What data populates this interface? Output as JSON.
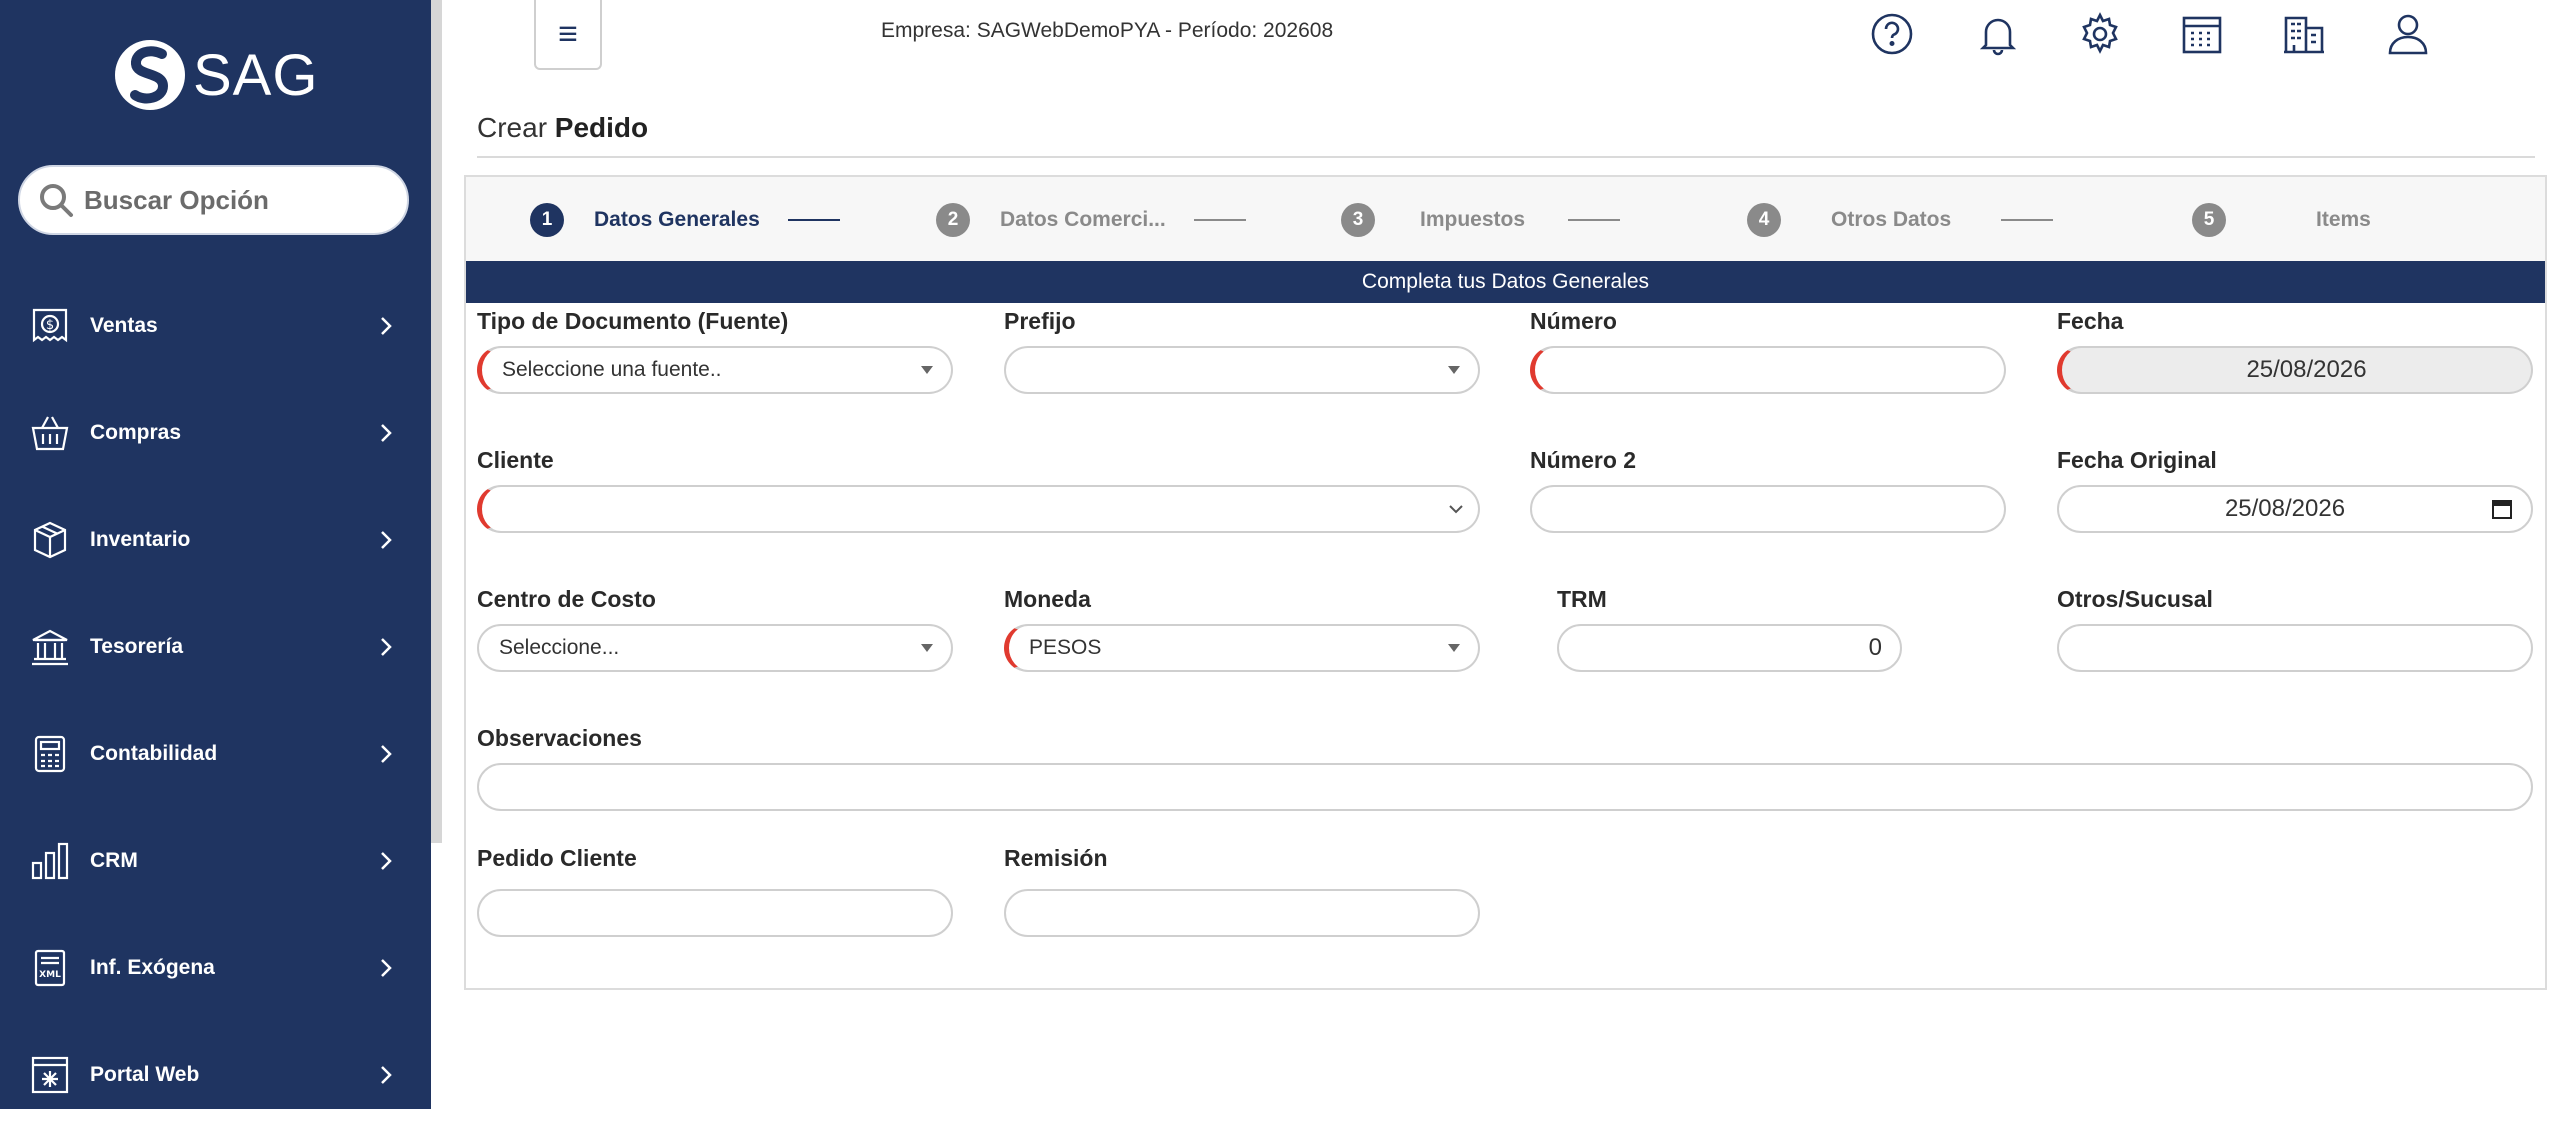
{
  "app": {
    "logo_text": "SAG"
  },
  "search": {
    "placeholder": "Buscar Opción"
  },
  "sidebar": {
    "items": [
      {
        "label": "Ventas",
        "icon": "receipt-dollar-icon"
      },
      {
        "label": "Compras",
        "icon": "basket-icon"
      },
      {
        "label": "Inventario",
        "icon": "box-icon"
      },
      {
        "label": "Tesorería",
        "icon": "bank-icon"
      },
      {
        "label": "Contabilidad",
        "icon": "calculator-icon"
      },
      {
        "label": "CRM",
        "icon": "bar-chart-icon"
      },
      {
        "label": "Inf. Exógena",
        "icon": "xml-file-icon"
      },
      {
        "label": "Portal Web",
        "icon": "portal-icon"
      }
    ]
  },
  "header": {
    "company_text": "Empresa: SAGWebDemoPYA - Período: 202608",
    "menu_glyph": "≡",
    "icons": [
      "help-icon",
      "bell-icon",
      "gear-icon",
      "calendar-icon",
      "building-icon",
      "user-icon"
    ]
  },
  "page": {
    "title_prefix": "Crear",
    "title_bold": "Pedido"
  },
  "stepper": {
    "steps": [
      {
        "num": "1",
        "label": "Datos Generales"
      },
      {
        "num": "2",
        "label": "Datos Comerci..."
      },
      {
        "num": "3",
        "label": "Impuestos"
      },
      {
        "num": "4",
        "label": "Otros Datos"
      },
      {
        "num": "5",
        "label": "Items"
      }
    ],
    "active_step": 1,
    "banner": "Completa tus Datos Generales"
  },
  "form": {
    "tipo_documento": {
      "label": "Tipo de Documento (Fuente)",
      "value": "Seleccione una fuente.."
    },
    "prefijo": {
      "label": "Prefijo",
      "value": ""
    },
    "numero": {
      "label": "Número",
      "value": ""
    },
    "fecha": {
      "label": "Fecha",
      "value": "25/08/2026"
    },
    "cliente": {
      "label": "Cliente",
      "value": ""
    },
    "numero2": {
      "label": "Número 2",
      "value": ""
    },
    "fecha_original": {
      "label": "Fecha Original",
      "value": "25/08/2026"
    },
    "centro_costo": {
      "label": "Centro de Costo",
      "value": "Seleccione..."
    },
    "moneda": {
      "label": "Moneda",
      "value": "PESOS"
    },
    "trm": {
      "label": "TRM",
      "value": "0"
    },
    "otros_sucusal": {
      "label": "Otros/Sucusal",
      "value": ""
    },
    "observaciones": {
      "label": "Observaciones",
      "value": ""
    },
    "pedido_cliente": {
      "label": "Pedido Cliente",
      "value": ""
    },
    "remision": {
      "label": "Remisión",
      "value": ""
    }
  },
  "colors": {
    "sidebar": "#1f3461",
    "required": "#e03a2f",
    "inactive": "#8a8a8a"
  }
}
